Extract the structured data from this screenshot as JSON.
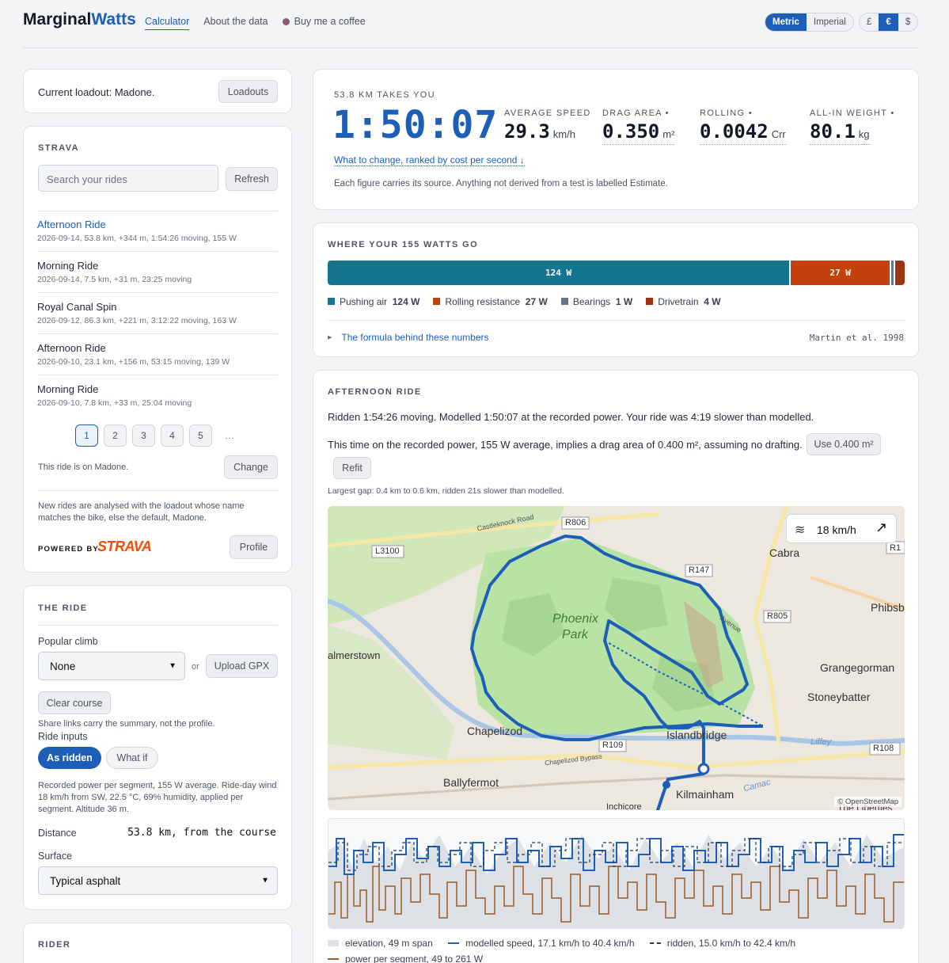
{
  "header": {
    "logo_a": "Marginal",
    "logo_b": "Watts",
    "nav": [
      "Calculator",
      "About the data",
      "Buy me a coffee"
    ],
    "units": [
      "Metric",
      "Imperial"
    ],
    "currencies": [
      "£",
      "€",
      "$"
    ]
  },
  "loadout": {
    "label": "Current loadout: Madone.",
    "button": "Loadouts"
  },
  "strava": {
    "heading": "STRAVA",
    "search_placeholder": "Search your rides",
    "refresh": "Refresh",
    "rides": [
      {
        "title": "Afternoon Ride",
        "meta": "2026-09-14, 53.8 km, +344 m, 1:54:26 moving, 155 W"
      },
      {
        "title": "Morning Ride",
        "meta": "2026-09-14, 7.5 km, +31 m, 23:25 moving"
      },
      {
        "title": "Royal Canal Spin",
        "meta": "2026-09-12, 86.3 km, +221 m, 3:12:22 moving, 163 W"
      },
      {
        "title": "Afternoon Ride",
        "meta": "2026-09-10, 23.1 km, +156 m, 53:15 moving, 139 W"
      },
      {
        "title": "Morning Ride",
        "meta": "2026-09-10, 7.8 km, +33 m, 25:04 moving"
      }
    ],
    "pages": [
      "1",
      "2",
      "3",
      "4",
      "5",
      "…"
    ],
    "on_bike": "This ride is on Madone.",
    "change": "Change",
    "note": "New rides are analysed with the loadout whose name matches the bike, else the default, Madone.",
    "powered": "POWERED BY",
    "brand": "STRAVA",
    "profile": "Profile"
  },
  "ride_panel": {
    "heading": "THE RIDE",
    "climb_label": "Popular climb",
    "climb_value": "None",
    "or": "or",
    "upload": "Upload GPX",
    "clear": "Clear course",
    "share_note": "Share links carry the summary, not the profile.",
    "inputs_label": "Ride inputs",
    "as_ridden": "As ridden",
    "what_if": "What if",
    "inputs_note": "Recorded power per segment, 155 W average. Ride-day wind 18 km/h from SW, 22.5 °C, 69% humidity, applied per segment. Altitude 36 m.",
    "distance_label": "Distance",
    "distance_value": "53.8 km, from the course",
    "surface_label": "Surface",
    "surface_value": "Typical asphalt"
  },
  "rider": {
    "heading": "RIDER"
  },
  "summary": {
    "takes": "53.8 KM TAKES YOU",
    "time": "1:50:07",
    "stats": [
      {
        "label": "AVERAGE SPEED",
        "value": "29.3",
        "unit": "km/h",
        "dot": ""
      },
      {
        "label": "DRAG AREA",
        "value": "0.350",
        "unit": "m²",
        "dot": "•"
      },
      {
        "label": "ROLLING",
        "value": "0.0042",
        "unit": "Crr",
        "dot": "•"
      },
      {
        "label": "ALL-IN WEIGHT",
        "value": "80.1",
        "unit": "kg",
        "dot": "•"
      }
    ],
    "link": "What to change, ranked by cost per second ↓",
    "note": "Each figure carries its source. Anything not derived from a test is labelled Estimate."
  },
  "watts": {
    "heading": "WHERE YOUR 155 WATTS GO",
    "total": 155,
    "parts": [
      {
        "name": "Pushing air",
        "value": 124,
        "label": "124 W",
        "color": "#14758f"
      },
      {
        "name": "Rolling resistance",
        "value": 27,
        "label": "27 W",
        "color": "#c2410c"
      },
      {
        "name": "Bearings",
        "value": 1,
        "label": "1 W",
        "color": "#64748b"
      },
      {
        "name": "Drivetrain",
        "value": 4,
        "label": "4 W",
        "color": "#9a3412"
      }
    ],
    "formula": "The formula behind these numbers",
    "citation": "Martin et al. 1998"
  },
  "afternoon": {
    "heading": "AFTERNOON RIDE",
    "line1": "Ridden 1:54:26 moving. Modelled 1:50:07 at the recorded power. Your ride was 4:19 slower than modelled.",
    "line2": "This time on the recorded power, 155 W average, implies a drag area of 0.400 m², assuming no drafting.",
    "use_btn": "Use 0.400 m²",
    "refit": "Refit",
    "gap": "Largest gap: 0.4 km to 0.6 km, ridden 21s slower than modelled.",
    "map": {
      "wind": "18 km/h",
      "attribution": "© OpenStreetMap",
      "labels": [
        "Castleknock Road",
        "R806",
        "L3100",
        "Cabra",
        "R147",
        "Phoenix",
        "Park",
        "R805",
        "Phibsb",
        "almerstown",
        "Grangegorman",
        "Stoneybatter",
        "Chapelizod",
        "R109",
        "Islandbridge",
        "R108",
        "Liffey",
        "Chapelizod Bypass",
        "Ballyfermot",
        "Kilmainham",
        "Camac",
        "Inchicore",
        "The Liberties",
        "R1",
        "Avenue"
      ]
    },
    "legend": [
      "elevation, 49 m span",
      "modelled speed, 17.1 km/h to 40.4 km/h",
      "ridden, 15.0 km/h to 42.4 km/h",
      "power per segment, 49 to 261 W"
    ]
  }
}
